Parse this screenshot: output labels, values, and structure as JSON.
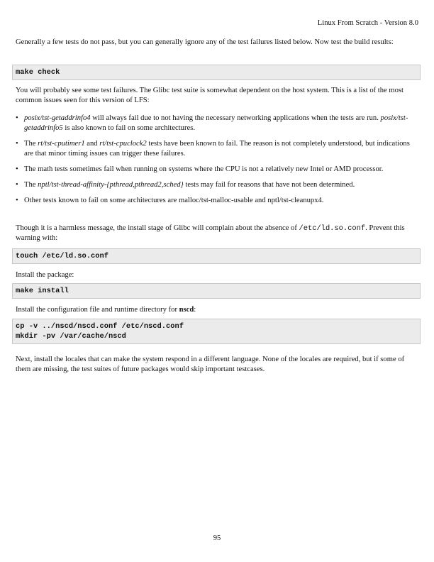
{
  "header": "Linux From Scratch - Version 8.0",
  "intro": "Generally a few tests do not pass, but you can generally ignore any of the test failures listed below. Now test the build results:",
  "cmd_check": "make check",
  "failures_intro": "You will probably see some test failures. The Glibc test suite is somewhat dependent on the host system. This is a list of the most common issues seen for this version of LFS:",
  "bullets": [
    {
      "a": "posix/tst-getaddrinfo4",
      "b": " will always fail due to not having the necessary networking applications when the tests are run. ",
      "c": "posix/tst-getaddrinfo5",
      "d": " is also known to fail on some architectures."
    },
    {
      "a": "The ",
      "b": "rt/tst-cputimer1",
      "c": " and ",
      "d": "rt/tst-cpuclock2",
      "e": " tests have been known to fail. The reason is not completely understood, but indications are that minor timing issues can trigger these failures."
    },
    {
      "text": "The math tests sometimes fail when running on systems where the CPU is not a relatively new Intel or AMD processor."
    },
    {
      "a": "The ",
      "b": "nptl/tst-thread-affinity-{pthread,pthread2,sched}",
      "c": " tests may fail for reasons that have not been determined."
    },
    {
      "text": "Other tests known to fail on some architectures are malloc/tst-malloc-usable and nptl/tst-cleanupx4."
    }
  ],
  "ldso_text": "Though it is a harmless message, the install stage of Glibc will complain about the absence of ",
  "ldso_path": "/etc/ld.so.conf",
  "ldso_text2": ". Prevent this warning with:",
  "cmd_touch": "touch /etc/ld.so.conf",
  "install_pkg": "Install the package:",
  "cmd_install": "make install",
  "config_text": "Install the configuration file and runtime directory for ",
  "config_bold": "nscd",
  "config_colon": ":",
  "cmd_nscd": "cp -v ../nscd/nscd.conf /etc/nscd.conf\nmkdir -pv /var/cache/nscd",
  "locales_text": "Next, install the locales that can make the system respond in a different language. None of the locales are required, but if some of them are missing, the test suites of future packages would skip important testcases.",
  "page_number": "95"
}
